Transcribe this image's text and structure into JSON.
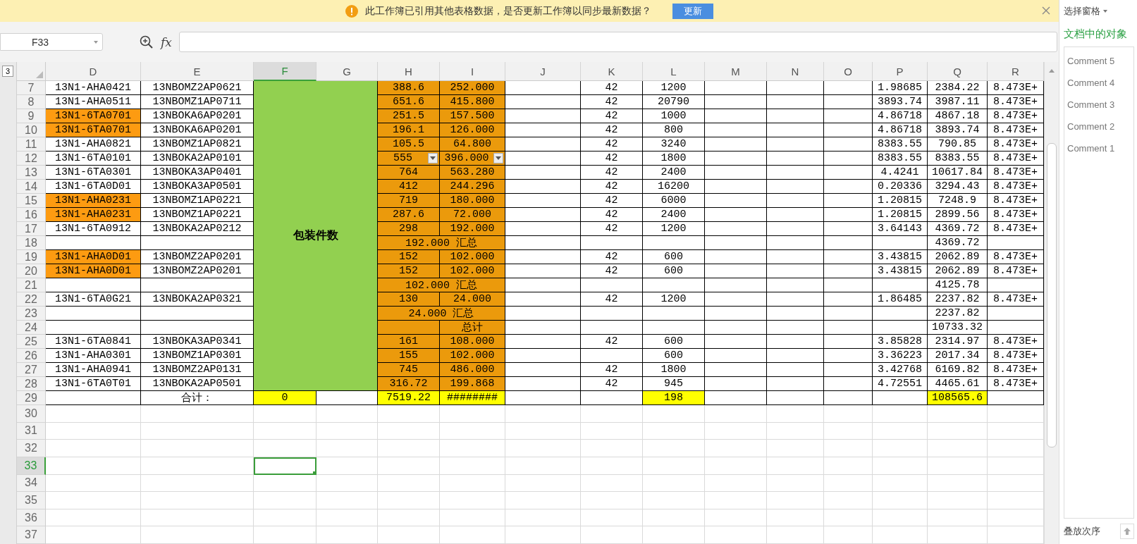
{
  "notification": {
    "message": "此工作簿已引用其他表格数据，是否更新工作簿以同步最新数据？",
    "button": "更新"
  },
  "formula_bar": {
    "name_box": "F33",
    "fx_label": "fx"
  },
  "right_panel": {
    "title": "选择窗格",
    "heading": "文档中的对象",
    "items": [
      "Comment 5",
      "Comment 4",
      "Comment 3",
      "Comment 2",
      "Comment 1"
    ],
    "footer": "叠放次序"
  },
  "sheet": {
    "outline_level": "3",
    "columns": [
      {
        "label": "D",
        "selected": false
      },
      {
        "label": "E",
        "selected": false
      },
      {
        "label": "F",
        "selected": true
      },
      {
        "label": "G",
        "selected": false
      },
      {
        "label": "H",
        "selected": false
      },
      {
        "label": "I",
        "selected": false
      },
      {
        "label": "J",
        "selected": false
      },
      {
        "label": "K",
        "selected": false
      },
      {
        "label": "L",
        "selected": false
      },
      {
        "label": "M",
        "selected": false
      },
      {
        "label": "N",
        "selected": false
      },
      {
        "label": "O",
        "selected": false
      },
      {
        "label": "P",
        "selected": false
      },
      {
        "label": "Q",
        "selected": false
      },
      {
        "label": "R",
        "selected": false
      }
    ],
    "rows": [
      {
        "number": "7",
        "selected": false,
        "cells": [
          {
            "text": "13N1-AHA0421"
          },
          {
            "text": "13NBOMZ2AP0621"
          },
          {
            "text": "包装件数",
            "color": "#92d050",
            "bold": true,
            "merged_across": true,
            "merged_down": true
          },
          {
            "text": "388.6",
            "color": "#eb9a0c"
          },
          {
            "text": "252.000",
            "color": "#eb9a0c"
          },
          {},
          {
            "text": "42"
          },
          {
            "text": "1200"
          },
          {},
          {},
          {},
          {
            "text": "1.98685"
          },
          {
            "text": "2384.22"
          },
          {
            "text": "8.473E+"
          }
        ]
      },
      {
        "number": "8",
        "selected": false,
        "cells": [
          {
            "text": "13N1-AHA0511"
          },
          {
            "text": "13NBOMZ1AP0711"
          },
          {
            "text": "651.6",
            "color": "#eb9a0c"
          },
          {
            "text": "415.800",
            "color": "#eb9a0c"
          },
          {},
          {
            "text": "42"
          },
          {
            "text": "20790"
          },
          {},
          {},
          {},
          {
            "text": "3893.74"
          },
          {
            "text": "3987.11"
          },
          {
            "text": "8.473E+"
          }
        ]
      },
      {
        "number": "9",
        "selected": false,
        "cells": [
          {
            "text": "13N1-6TA0701",
            "color": "#fd9b11"
          },
          {
            "text": "13NBOKA6AP0201"
          },
          {
            "text": "251.5",
            "color": "#eb9a0c"
          },
          {
            "text": "157.500",
            "color": "#eb9a0c"
          },
          {},
          {
            "text": "42"
          },
          {
            "text": "1000"
          },
          {},
          {},
          {},
          {
            "text": "4.86718"
          },
          {
            "text": "4867.18"
          },
          {
            "text": "8.473E+"
          }
        ]
      },
      {
        "number": "10",
        "selected": false,
        "cells": [
          {
            "text": "13N1-6TA0701",
            "color": "#fd9b11"
          },
          {
            "text": "13NBOKA6AP0201"
          },
          {
            "text": "196.1",
            "color": "#eb9a0c"
          },
          {
            "text": "126.000",
            "color": "#eb9a0c"
          },
          {},
          {
            "text": "42"
          },
          {
            "text": "800"
          },
          {},
          {},
          {},
          {
            "text": "4.86718"
          },
          {
            "text": "3893.74"
          },
          {
            "text": "8.473E+"
          }
        ]
      },
      {
        "number": "11",
        "selected": false,
        "cells": [
          {
            "text": "13N1-AHA0821"
          },
          {
            "text": "13NBOMZ1AP0821"
          },
          {
            "text": "105.5",
            "color": "#eb9a0c"
          },
          {
            "text": "64.800",
            "color": "#eb9a0c"
          },
          {},
          {
            "text": "42"
          },
          {
            "text": "3240"
          },
          {},
          {},
          {},
          {
            "text": "8383.55"
          },
          {
            "text": "790.85"
          },
          {
            "text": "8.473E+"
          }
        ]
      },
      {
        "number": "12",
        "selected": false,
        "cells": [
          {
            "text": "13N1-6TA0101"
          },
          {
            "text": "13NBOKA2AP0101"
          },
          {
            "text": "555",
            "color": "#eb9a0c",
            "dropdown": true
          },
          {
            "text": "396.000",
            "color": "#eb9a0c",
            "dropdown": true
          },
          {},
          {
            "text": "42"
          },
          {
            "text": "1800"
          },
          {},
          {},
          {},
          {
            "text": "8383.55"
          },
          {
            "text": "8383.55"
          },
          {
            "text": "8.473E+"
          }
        ]
      },
      {
        "number": "13",
        "selected": false,
        "cells": [
          {
            "text": "13N1-6TA0301"
          },
          {
            "text": "13NBOKA3AP0401"
          },
          {
            "text": "764",
            "color": "#eb9a0c"
          },
          {
            "text": "563.280",
            "color": "#eb9a0c"
          },
          {},
          {
            "text": "42"
          },
          {
            "text": "2400"
          },
          {},
          {},
          {},
          {
            "text": "4.4241"
          },
          {
            "text": "10617.84"
          },
          {
            "text": "8.473E+"
          }
        ]
      },
      {
        "number": "14",
        "selected": false,
        "cells": [
          {
            "text": "13N1-6TA0D01"
          },
          {
            "text": "13NBOKA3AP0501"
          },
          {
            "text": "412",
            "color": "#eb9a0c"
          },
          {
            "text": "244.296",
            "color": "#eb9a0c"
          },
          {},
          {
            "text": "42"
          },
          {
            "text": "16200"
          },
          {},
          {},
          {},
          {
            "text": "0.20336"
          },
          {
            "text": "3294.43"
          },
          {
            "text": "8.473E+"
          }
        ]
      },
      {
        "number": "15",
        "selected": false,
        "cells": [
          {
            "text": "13N1-AHA0231",
            "color": "#fd9b11"
          },
          {
            "text": "13NBOMZ1AP0221"
          },
          {
            "text": "719",
            "color": "#eb9a0c"
          },
          {
            "text": "180.000",
            "color": "#eb9a0c"
          },
          {},
          {
            "text": "42"
          },
          {
            "text": "6000"
          },
          {},
          {},
          {},
          {
            "text": "1.20815"
          },
          {
            "text": "7248.9"
          },
          {
            "text": "8.473E+"
          }
        ]
      },
      {
        "number": "16",
        "selected": false,
        "cells": [
          {
            "text": "13N1-AHA0231",
            "color": "#fd9b11"
          },
          {
            "text": "13NBOMZ1AP0221"
          },
          {
            "text": "287.6",
            "color": "#eb9a0c"
          },
          {
            "text": "72.000",
            "color": "#eb9a0c"
          },
          {},
          {
            "text": "42"
          },
          {
            "text": "2400"
          },
          {},
          {},
          {},
          {
            "text": "1.20815"
          },
          {
            "text": "2899.56"
          },
          {
            "text": "8.473E+"
          }
        ]
      },
      {
        "number": "17",
        "selected": false,
        "cells": [
          {
            "text": "13N1-6TA0912"
          },
          {
            "text": "13NBOKA2AP0212"
          },
          {
            "text": "298",
            "color": "#eb9a0c"
          },
          {
            "text": "192.000",
            "color": "#eb9a0c"
          },
          {},
          {
            "text": "42"
          },
          {
            "text": "1200"
          },
          {},
          {},
          {},
          {
            "text": "3.64143"
          },
          {
            "text": "4369.72"
          },
          {
            "text": "8.473E+"
          }
        ]
      },
      {
        "number": "18",
        "selected": false,
        "cells": [
          {},
          {},
          {
            "text": "192.000 汇总",
            "color": "#eb9a0c",
            "merged_across": true
          },
          {},
          {},
          {},
          {},
          {},
          {},
          {},
          {
            "text": "4369.72"
          },
          {}
        ]
      },
      {
        "number": "19",
        "selected": false,
        "cells": [
          {
            "text": "13N1-AHA0D01",
            "color": "#fd9b11"
          },
          {
            "text": "13NBOMZ2AP0201"
          },
          {
            "text": "152",
            "color": "#eb9a0c"
          },
          {
            "text": "102.000",
            "color": "#eb9a0c"
          },
          {},
          {
            "text": "42"
          },
          {
            "text": "600"
          },
          {},
          {},
          {},
          {
            "text": "3.43815"
          },
          {
            "text": "2062.89"
          },
          {
            "text": "8.473E+"
          }
        ]
      },
      {
        "number": "20",
        "selected": false,
        "cells": [
          {
            "text": "13N1-AHA0D01",
            "color": "#fd9b11"
          },
          {
            "text": "13NBOMZ2AP0201"
          },
          {
            "text": "152",
            "color": "#eb9a0c"
          },
          {
            "text": "102.000",
            "color": "#eb9a0c"
          },
          {},
          {
            "text": "42"
          },
          {
            "text": "600"
          },
          {},
          {},
          {},
          {
            "text": "3.43815"
          },
          {
            "text": "2062.89"
          },
          {
            "text": "8.473E+"
          }
        ]
      },
      {
        "number": "21",
        "selected": false,
        "cells": [
          {},
          {},
          {
            "text": "102.000 汇总",
            "color": "#eb9a0c",
            "merged_across": true
          },
          {},
          {},
          {},
          {},
          {},
          {},
          {},
          {
            "text": "4125.78"
          },
          {}
        ]
      },
      {
        "number": "22",
        "selected": false,
        "cells": [
          {
            "text": "13N1-6TA0G21"
          },
          {
            "text": "13NBOKA2AP0321"
          },
          {
            "text": "130",
            "color": "#eb9a0c"
          },
          {
            "text": "24.000",
            "color": "#eb9a0c"
          },
          {},
          {
            "text": "42"
          },
          {
            "text": "1200"
          },
          {},
          {},
          {},
          {
            "text": "1.86485"
          },
          {
            "text": "2237.82"
          },
          {
            "text": "8.473E+"
          }
        ]
      },
      {
        "number": "23",
        "selected": false,
        "cells": [
          {},
          {},
          {
            "text": "24.000 汇总",
            "color": "#eb9a0c",
            "merged_across": true
          },
          {},
          {},
          {},
          {},
          {},
          {},
          {},
          {
            "text": "2237.82"
          },
          {}
        ]
      },
      {
        "number": "24",
        "selected": false,
        "cells": [
          {},
          {},
          {
            "color": "#eb9a0c"
          },
          {
            "text": "总计",
            "color": "#eb9a0c"
          },
          {},
          {},
          {},
          {},
          {},
          {},
          {},
          {
            "text": "10733.32"
          },
          {}
        ]
      },
      {
        "number": "25",
        "selected": false,
        "cells": [
          {
            "text": "13N1-6TA0841"
          },
          {
            "text": "13NBOKA3AP0341"
          },
          {
            "text": "161",
            "color": "#eb9a0c"
          },
          {
            "text": "108.000",
            "color": "#eb9a0c"
          },
          {},
          {
            "text": "42"
          },
          {
            "text": "600"
          },
          {},
          {},
          {},
          {
            "text": "3.85828"
          },
          {
            "text": "2314.97"
          },
          {
            "text": "8.473E+"
          }
        ]
      },
      {
        "number": "26",
        "selected": false,
        "cells": [
          {
            "text": "13N1-AHA0301"
          },
          {
            "text": "13NBOMZ1AP0301"
          },
          {
            "text": "155",
            "color": "#eb9a0c"
          },
          {
            "text": "102.000",
            "color": "#eb9a0c"
          },
          {},
          {},
          {
            "text": "600"
          },
          {},
          {},
          {},
          {
            "text": "3.36223"
          },
          {
            "text": "2017.34"
          },
          {
            "text": "8.473E+"
          }
        ]
      },
      {
        "number": "27",
        "selected": false,
        "cells": [
          {
            "text": "13N1-AHA0941"
          },
          {
            "text": "13NBOMZ2AP0131"
          },
          {
            "text": "745",
            "color": "#eb9a0c"
          },
          {
            "text": "486.000",
            "color": "#eb9a0c"
          },
          {},
          {
            "text": "42"
          },
          {
            "text": "1800"
          },
          {},
          {},
          {},
          {
            "text": "3.42768"
          },
          {
            "text": "6169.82"
          },
          {
            "text": "8.473E+"
          }
        ]
      },
      {
        "number": "28",
        "selected": false,
        "cells": [
          {
            "text": "13N1-6TA0T01"
          },
          {
            "text": "13NBOKA2AP0501"
          },
          {
            "text": "316.72",
            "color": "#eb9a0c"
          },
          {
            "text": "199.868",
            "color": "#eb9a0c"
          },
          {},
          {
            "text": "42"
          },
          {
            "text": "945"
          },
          {},
          {},
          {},
          {
            "text": "4.72551"
          },
          {
            "text": "4465.61"
          },
          {
            "text": "8.473E+"
          }
        ]
      },
      {
        "number": "29",
        "selected": false,
        "cells": [
          {},
          {
            "text": "合计："
          },
          {
            "text": "0",
            "color": "#ffff00"
          },
          {},
          {
            "text": "7519.22",
            "color": "#ffff00"
          },
          {
            "text": "########",
            "color": "#ffff00"
          },
          {},
          {},
          {
            "text": "198",
            "color": "#ffff00"
          },
          {},
          {},
          {},
          {},
          {
            "text": "108565.6",
            "color": "#ffff00"
          },
          {}
        ]
      },
      {
        "number": "30",
        "selected": false
      },
      {
        "number": "31",
        "selected": false
      },
      {
        "number": "32",
        "selected": false
      },
      {
        "number": "33",
        "selected": true
      },
      {
        "number": "34",
        "selected": false
      },
      {
        "number": "35",
        "selected": false
      },
      {
        "number": "36",
        "selected": false
      },
      {
        "number": "37",
        "selected": false
      }
    ]
  }
}
